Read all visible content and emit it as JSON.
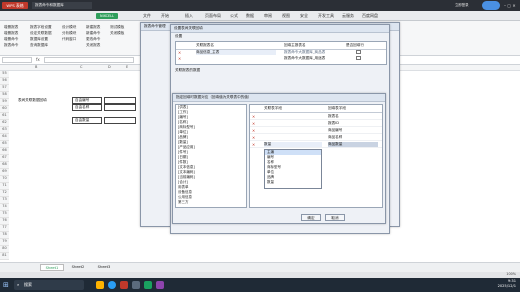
{
  "titlebar": {
    "brand": "WPS 表格",
    "doc_name": "报表命令和数据库",
    "time_right": "",
    "login": "立即登录"
  },
  "ribbon_tabs": [
    "文件",
    "开始",
    "插入",
    "页面布局",
    "公式",
    "数据",
    "审阅",
    "视图",
    "安全",
    "开发工具",
    "云服务",
    "百度网盘"
  ],
  "ribbon_highlight": "NIXCELL",
  "ribbon_groups": {
    "col1": [
      "增删报表",
      "增删报表",
      "增删命令",
      "报表命令"
    ],
    "col2": [
      "报表字段设置",
      "设定关联数据",
      "数据库设置",
      "查询数据库"
    ],
    "col3": [
      "设计模块",
      "分析模块",
      "代码窗口"
    ],
    "col4": [
      "新建报表",
      "新建命令",
      "更改命令",
      "关闭报表"
    ],
    "col5": [
      "测试模板",
      "关闭模板"
    ]
  },
  "formulabar": {
    "namebox": "",
    "value": ""
  },
  "sheet": {
    "rows": [
      "55",
      "56",
      "57",
      "58",
      "59",
      "60",
      "61",
      "62",
      "63",
      "64",
      "65",
      "66",
      "67",
      "68",
      "69",
      "70",
      "71",
      "72",
      "73",
      "74",
      "75",
      "76",
      "77",
      "78",
      "79",
      "80",
      "81"
    ],
    "cols": [
      "B",
      "C",
      "D",
      "E"
    ],
    "label_main": "表间关联数据回填",
    "field_a": "自由编号",
    "field_b": "自由名称",
    "field_c": "自由数量"
  },
  "sheettabs": [
    "Sheet1",
    "Sheet2",
    "Sheet3"
  ],
  "status": {
    "zoom": "100%"
  },
  "taskbar": {
    "search": "搜索",
    "time": "9:31",
    "date": "2025/12/1"
  },
  "win_back": {
    "title": "报表命令管理"
  },
  "win_mid": {
    "title": "设置表间关联回填",
    "tab": "设置",
    "header1": "关联报表名",
    "header2": "回填主报表名",
    "header3": "是否回填行",
    "rows": [
      {
        "a": "商品信息_主表",
        "b": "报表命令大数据库_商品表"
      },
      {
        "a": "",
        "b": "报表命令大数据库_用途表"
      }
    ],
    "section": "关联报表的数据",
    "side_items": [
      "公",
      "查",
      "表",
      "表",
      "表",
      "表",
      "表",
      "表"
    ]
  },
  "win_front": {
    "title": "指定回填时数据对应（回填值为关联表中的值）",
    "left_tree": [
      "[供表]",
      "[工作]",
      "[编号]",
      "[名称]",
      "[商标型号]",
      "[单位]",
      "[品牌]",
      "[数量]",
      "[产品应用]",
      "[件号]",
      "[日期]",
      "[件数]",
      "[文本信息]",
      "[文本编码]",
      "[当前编码]",
      "[合计]"
    ],
    "tree_groups": [
      "用表单",
      "设备信息",
      "公用信息",
      "第三方"
    ],
    "grid_header1": "关联表字段",
    "grid_header2": "回填表字段",
    "grid_rows": [
      {
        "a": "",
        "b": "报表名"
      },
      {
        "a": "",
        "b": "报表ID"
      },
      {
        "a": "",
        "b": "商品编号"
      },
      {
        "a": "",
        "b": "商品名称"
      },
      {
        "a": "数量",
        "b": "商品数量"
      }
    ],
    "dropdown_items": [
      "主编",
      "编号",
      "名称",
      "商标型号",
      "单位",
      "品牌",
      "数量"
    ],
    "ok_label": "确定",
    "cancel_label": "取消"
  }
}
